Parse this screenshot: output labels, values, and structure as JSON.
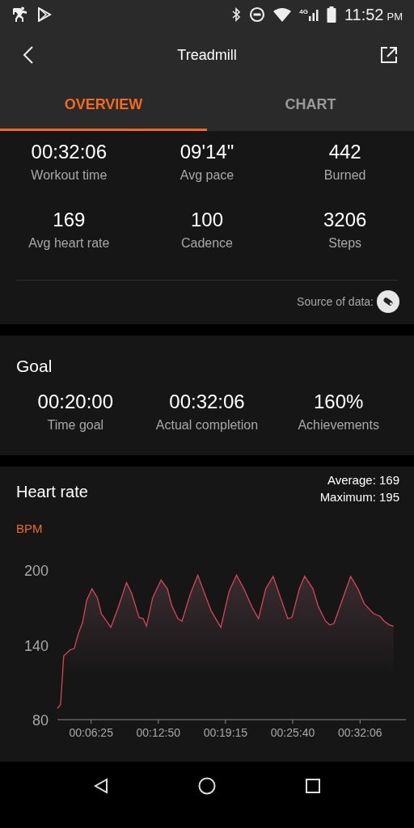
{
  "status_bar": {
    "network": "4G",
    "time": "11:52",
    "period": "PM"
  },
  "header": {
    "title": "Treadmill"
  },
  "tabs": [
    {
      "label": "OVERVIEW",
      "selected": true
    },
    {
      "label": "CHART",
      "selected": false
    }
  ],
  "stats": [
    {
      "value": "00:32:06",
      "label": "Workout time"
    },
    {
      "value": "09'14\"",
      "label": "Avg pace"
    },
    {
      "value": "442",
      "label": "Burned"
    },
    {
      "value": "169",
      "label": "Avg heart rate"
    },
    {
      "value": "100",
      "label": "Cadence"
    },
    {
      "value": "3206",
      "label": "Steps"
    }
  ],
  "source": {
    "label": "Source of data:"
  },
  "goal": {
    "title": "Goal",
    "items": [
      {
        "value": "00:20:00",
        "label": "Time goal"
      },
      {
        "value": "00:32:06",
        "label": "Actual completion"
      },
      {
        "value": "160%",
        "label": "Achievements"
      }
    ]
  },
  "heart_rate": {
    "title": "Heart rate",
    "average": "Average: 169",
    "maximum": "Maximum: 195",
    "unit": "BPM",
    "chart_data": {
      "type": "area",
      "xlim": [
        3.2,
        36.5
      ],
      "ylim": [
        80,
        200
      ],
      "yticks": [
        80,
        140,
        200
      ],
      "xticks": [
        {
          "value": 6.417,
          "label": "00:06:25"
        },
        {
          "value": 12.833,
          "label": "00:12:50"
        },
        {
          "value": 19.25,
          "label": "00:19:15"
        },
        {
          "value": 25.667,
          "label": "00:25:40"
        },
        {
          "value": 32.1,
          "label": "00:32:06"
        }
      ],
      "x": [
        3.2,
        3.5,
        3.8,
        4.4,
        4.8,
        5.2,
        5.6,
        6.0,
        6.5,
        7.0,
        7.4,
        8.3,
        9.0,
        9.8,
        10.3,
        11.0,
        11.4,
        11.7,
        12.3,
        13.1,
        13.7,
        14.1,
        14.7,
        15.1,
        15.9,
        16.6,
        17.4,
        17.9,
        18.8,
        19.6,
        20.3,
        21.0,
        21.8,
        22.4,
        23.1,
        23.8,
        24.5,
        25.2,
        25.6,
        26.3,
        26.8,
        27.6,
        28.1,
        28.8,
        29.2,
        29.6,
        30.4,
        31.2,
        31.9,
        32.5,
        33.4,
        34.0,
        34.4,
        34.9,
        35.3
      ],
      "series": [
        {
          "color": "#d6455e",
          "values": [
            89,
            92,
            131,
            136,
            137,
            149,
            158,
            176,
            185,
            178,
            165,
            154,
            170,
            190,
            181,
            162,
            161,
            155,
            178,
            192,
            185,
            172,
            161,
            159,
            181,
            196,
            178,
            167,
            154,
            183,
            196,
            185,
            170,
            161,
            185,
            195,
            178,
            161,
            162,
            185,
            195,
            185,
            171,
            159,
            156,
            157,
            176,
            195,
            185,
            173,
            165,
            163,
            159,
            156,
            155
          ]
        }
      ]
    }
  }
}
